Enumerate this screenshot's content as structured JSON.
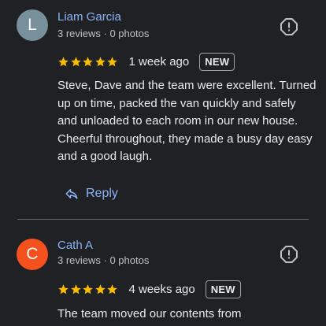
{
  "reviews": [
    {
      "initial": "L",
      "avatar_color": "#78909c",
      "name": "Liam Garcia",
      "meta": "3 reviews · 0 photos",
      "rating": 5,
      "time": "1 week ago",
      "badge": "NEW",
      "text": "Steve, Dave and the team were excellent. Turned up on time, packed the van quickly and safely and unloaded to each room in our new house. Cheerful throughout, they made a busy day easy and a good laugh.",
      "reply_label": "Reply"
    },
    {
      "initial": "C",
      "avatar_color": "#f4511e",
      "name": "Cath A",
      "meta": "3 reviews · 0 photos",
      "rating": 5,
      "time": "4 weeks ago",
      "badge": "NEW",
      "text": "The team moved our contents from"
    }
  ],
  "colors": {
    "background": "#202124",
    "link": "#8ab4f8",
    "star": "#fbbc04",
    "divider": "#5f6368"
  },
  "icons": {
    "flag": "report-flag-icon",
    "reply": "reply-arrow-icon",
    "star": "star-icon"
  }
}
